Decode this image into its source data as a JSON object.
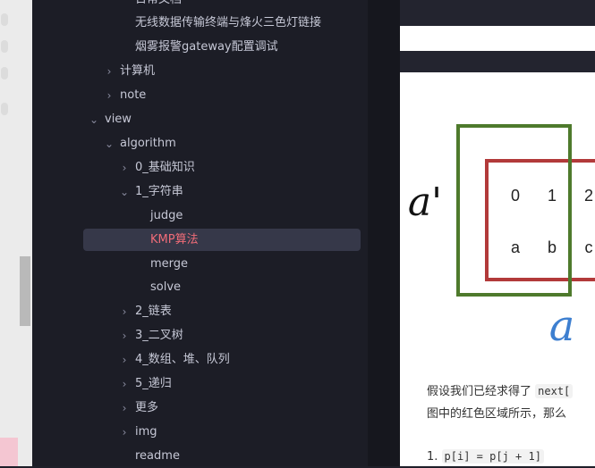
{
  "sidebar": {
    "items": [
      {
        "label": "日常文档",
        "chevron": ""
      },
      {
        "label": "无线数据传输终端与烽火三色灯链接",
        "chevron": ""
      },
      {
        "label": "烟雾报警gateway配置调试",
        "chevron": ""
      },
      {
        "label": "计算机",
        "chevron": "›"
      },
      {
        "label": "note",
        "chevron": "›"
      },
      {
        "label": "view",
        "chevron": "⌄"
      },
      {
        "label": "algorithm",
        "chevron": "⌄"
      },
      {
        "label": "0_基础知识",
        "chevron": "›"
      },
      {
        "label": "1_字符串",
        "chevron": "⌄"
      },
      {
        "label": "judge",
        "chevron": ""
      },
      {
        "label": "KMP算法",
        "chevron": ""
      },
      {
        "label": "merge",
        "chevron": ""
      },
      {
        "label": "solve",
        "chevron": ""
      },
      {
        "label": "2_链表",
        "chevron": "›"
      },
      {
        "label": "3_二叉树",
        "chevron": "›"
      },
      {
        "label": "4_数组、堆、队列",
        "chevron": "›"
      },
      {
        "label": "5_递归",
        "chevron": "›"
      },
      {
        "label": "更多",
        "chevron": "›"
      },
      {
        "label": "img",
        "chevron": "›"
      },
      {
        "label": "readme",
        "chevron": ""
      }
    ],
    "active_index": 10
  },
  "content": {
    "figure": {
      "left_label": "a'",
      "bottom_label": "a",
      "row1": [
        "0",
        "1",
        "2"
      ],
      "row2": [
        "a",
        "b",
        "c"
      ],
      "colors": {
        "green": "#4e7a2c",
        "red": "#b23a3a",
        "blue": "#3d7fd0"
      }
    },
    "para1_prefix": "假设我们已经求得了",
    "para1_code": "next[",
    "para2": "图中的红色区域所示，那么",
    "list_num": "1.",
    "list_code": "p[i] = p[j + 1]"
  }
}
